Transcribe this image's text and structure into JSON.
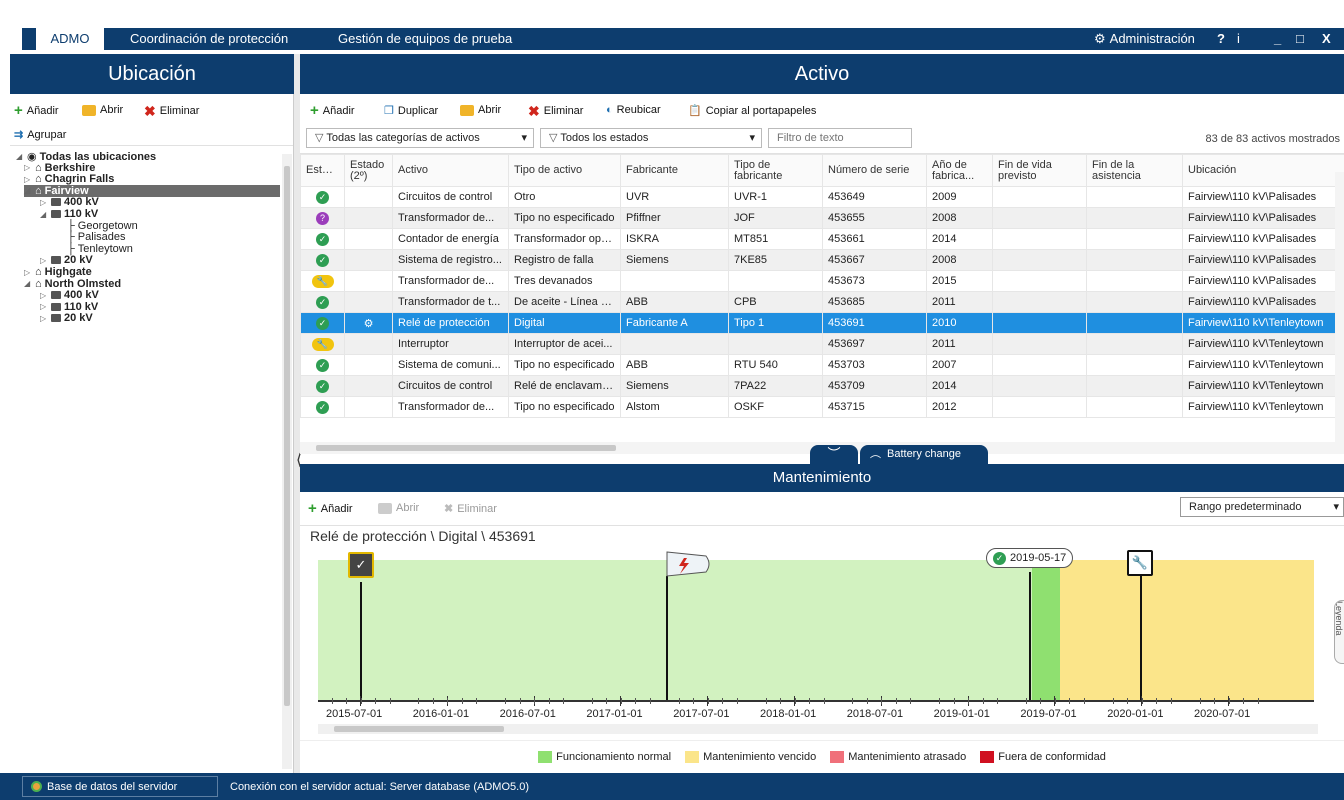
{
  "app": {
    "tabs": [
      "ADMO",
      "Coordinación de protección",
      "Gestión de equipos de prueba"
    ],
    "admin_label": "Administración",
    "window_controls": [
      "?",
      "i",
      "_",
      "□",
      "X"
    ]
  },
  "left_panel": {
    "title": "Ubicación",
    "toolbar": {
      "add": "Añadir",
      "open": "Abrir",
      "delete": "Eliminar",
      "group": "Agrupar"
    },
    "tree": [
      {
        "label": "Todas las ubicaciones",
        "level": 0
      },
      {
        "label": "Berkshire",
        "level": 1
      },
      {
        "label": "Chagrin Falls",
        "level": 1
      },
      {
        "label": "Fairview",
        "level": 1,
        "selected": true
      },
      {
        "label": "400 kV",
        "level": 2
      },
      {
        "label": "110 kV",
        "level": 2
      },
      {
        "label": "Georgetown",
        "level": 3
      },
      {
        "label": "Palisades",
        "level": 3
      },
      {
        "label": "Tenleytown",
        "level": 3
      },
      {
        "label": "20 kV",
        "level": 2
      },
      {
        "label": "Highgate",
        "level": 1
      },
      {
        "label": "North Olmsted",
        "level": 1
      },
      {
        "label": "400 kV",
        "level": 2
      },
      {
        "label": "110 kV",
        "level": 2
      },
      {
        "label": "20 kV",
        "level": 2
      }
    ]
  },
  "asset_panel": {
    "title": "Activo",
    "toolbar": {
      "add": "Añadir",
      "duplicate": "Duplicar",
      "open": "Abrir",
      "delete": "Eliminar",
      "relocate": "Reubicar",
      "copy": "Copiar al portapapeles"
    },
    "filters": {
      "categories": "Todas las categorías de activos",
      "states": "Todos los estados",
      "text_placeholder": "Filtro de texto"
    },
    "count_label": "83 de 83 activos mostrados",
    "columns": [
      "Estado",
      "Estado (2º)",
      "Activo",
      "Tipo de activo",
      "Fabricante",
      "Tipo de fabricante",
      "Número de serie",
      "Año de fabrica...",
      "Fin de vida previsto",
      "Fin de la asistencia",
      "Ubicación"
    ],
    "rows": [
      {
        "status": "ok",
        "status2": "",
        "asset": "Circuitos de control",
        "type": "Otro",
        "maker": "UVR",
        "maker_type": "UVR-1",
        "serial": "453649",
        "year": "2009",
        "eol": "",
        "eos": "",
        "location": "Fairview\\110 kV\\Palisades"
      },
      {
        "status": "pending",
        "status2": "",
        "asset": "Transformador de...",
        "type": "Tipo no especificado",
        "maker": "Pfiffner",
        "maker_type": "JOF",
        "serial": "453655",
        "year": "2008",
        "eol": "",
        "eos": "",
        "location": "Fairview\\110 kV\\Palisades"
      },
      {
        "status": "ok",
        "status2": "",
        "asset": "Contador de energía",
        "type": "Transformador ope...",
        "maker": "ISKRA",
        "maker_type": "MT851",
        "serial": "453661",
        "year": "2014",
        "eol": "",
        "eos": "",
        "location": "Fairview\\110 kV\\Palisades"
      },
      {
        "status": "ok",
        "status2": "",
        "asset": "Sistema de registro...",
        "type": "Registro de falla",
        "maker": "Siemens",
        "maker_type": "7KE85",
        "serial": "453667",
        "year": "2008",
        "eol": "",
        "eos": "",
        "location": "Fairview\\110 kV\\Palisades"
      },
      {
        "status": "warn",
        "status2": "",
        "asset": "Transformador de...",
        "type": "Tres devanados",
        "maker": "",
        "maker_type": "",
        "serial": "453673",
        "year": "2015",
        "eol": "",
        "eos": "",
        "location": "Fairview\\110 kV\\Palisades"
      },
      {
        "status": "ok",
        "status2": "",
        "asset": "Transformador de t...",
        "type": "De aceite - Línea a...",
        "maker": "ABB",
        "maker_type": "CPB",
        "serial": "453685",
        "year": "2011",
        "eol": "",
        "eos": "",
        "location": "Fairview\\110 kV\\Palisades"
      },
      {
        "status": "ok",
        "status2": "gear",
        "asset": "Relé de protección",
        "type": "Digital",
        "maker": "Fabricante A",
        "maker_type": "Tipo 1",
        "serial": "453691",
        "year": "2010",
        "eol": "",
        "eos": "",
        "location": "Fairview\\110 kV\\Tenleytown",
        "selected": true
      },
      {
        "status": "warn",
        "status2": "",
        "asset": "Interruptor",
        "type": "Interruptor de acei...",
        "maker": "",
        "maker_type": "",
        "serial": "453697",
        "year": "2011",
        "eol": "",
        "eos": "",
        "location": "Fairview\\110 kV\\Tenleytown"
      },
      {
        "status": "ok",
        "status2": "",
        "asset": "Sistema de comuni...",
        "type": "Tipo no especificado",
        "maker": "ABB",
        "maker_type": "RTU 540",
        "serial": "453703",
        "year": "2007",
        "eol": "",
        "eos": "",
        "location": "Fairview\\110 kV\\Tenleytown"
      },
      {
        "status": "ok",
        "status2": "",
        "asset": "Circuitos de control",
        "type": "Relé de enclavamie...",
        "maker": "Siemens",
        "maker_type": "7PA22",
        "serial": "453709",
        "year": "2014",
        "eol": "",
        "eos": "",
        "location": "Fairview\\110 kV\\Tenleytown"
      },
      {
        "status": "ok",
        "status2": "",
        "asset": "Transformador de...",
        "type": "Tipo no especificado",
        "maker": "Alstom",
        "maker_type": "OSKF",
        "serial": "453715",
        "year": "2012",
        "eol": "",
        "eos": "",
        "location": "Fairview\\110 kV\\Tenleytown"
      }
    ],
    "bottom_tab": "Battery change"
  },
  "maintenance": {
    "title": "Mantenimiento",
    "toolbar": {
      "add": "Añadir",
      "open": "Abrir",
      "delete": "Eliminar"
    },
    "range_select": "Rango predeterminado",
    "breadcrumb": "Relé de protección \\ Digital \\ 453691",
    "date_badge": "2019-05-17",
    "side_tab": "Leyenda",
    "ticks": [
      "2015-07-01",
      "2016-01-01",
      "2016-07-01",
      "2017-01-01",
      "2017-07-01",
      "2018-01-01",
      "2018-07-01",
      "2019-01-01",
      "2019-07-01",
      "2020-01-01",
      "2020-07-01"
    ],
    "legend": [
      {
        "label": "Funcionamiento normal",
        "color": "#8fe070"
      },
      {
        "label": "Mantenimiento vencido",
        "color": "#fbe58a"
      },
      {
        "label": "Mantenimiento atrasado",
        "color": "#f0707a"
      },
      {
        "label": "Fuera de conformidad",
        "color": "#d01020"
      }
    ]
  },
  "status_bar": {
    "db_label": "Base de datos del servidor",
    "connection": "Conexión con el servidor actual: Server database (ADMO5.0)"
  }
}
